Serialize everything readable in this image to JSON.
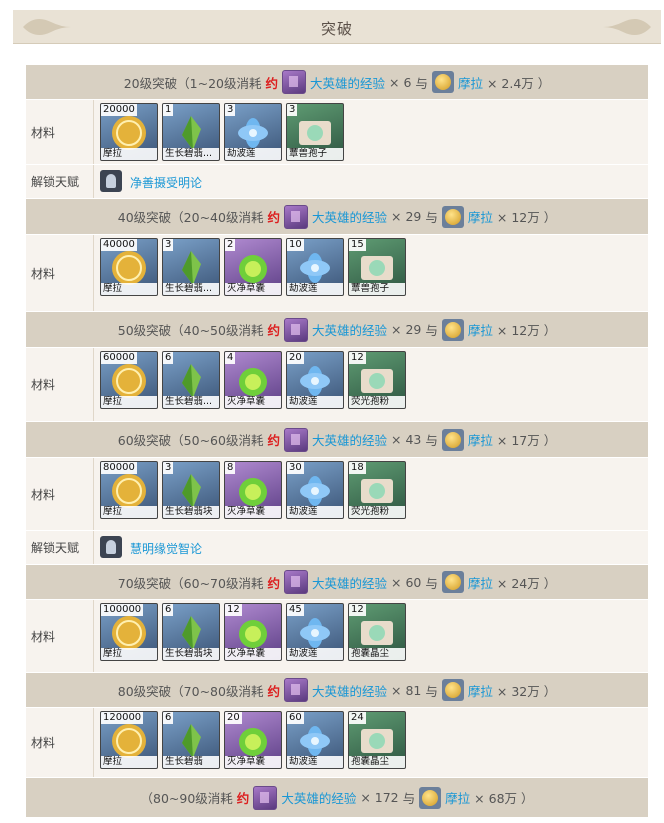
{
  "header": {
    "title": "突破"
  },
  "labels": {
    "materials": "材料",
    "unlock_talent": "解锁天赋",
    "about": "约",
    "and": "与"
  },
  "currency": {
    "exp_name": "大英雄的经验",
    "coin_name": "摩拉"
  },
  "phases": [
    {
      "text": "20级突破（1~20级消耗",
      "exp_count": "× 6",
      "mora_count": "× 2.4万 ）",
      "items": [
        {
          "count": "20000",
          "name": "摩拉",
          "icon": "mora-coin-icon"
        },
        {
          "count": "1",
          "name": "生长碧翡...",
          "icon": "green-gem-icon"
        },
        {
          "count": "3",
          "name": "劫波莲",
          "icon": "blue-lotus-icon"
        },
        {
          "count": "3",
          "name": "蕈兽孢子",
          "icon": "spore-icon"
        }
      ],
      "talent": "净善摄受明论"
    },
    {
      "text": "40级突破（20~40级消耗",
      "exp_count": "× 29",
      "mora_count": "× 12万 ）",
      "items": [
        {
          "count": "40000",
          "name": "摩拉",
          "icon": "mora-coin-icon"
        },
        {
          "count": "3",
          "name": "生长碧翡...",
          "icon": "green-gem-icon"
        },
        {
          "count": "2",
          "name": "灭净草囊",
          "icon": "herb-pod-icon"
        },
        {
          "count": "10",
          "name": "劫波莲",
          "icon": "blue-lotus-icon"
        },
        {
          "count": "15",
          "name": "蕈兽孢子",
          "icon": "spore-icon"
        }
      ]
    },
    {
      "text": "50级突破（40~50级消耗",
      "exp_count": "× 29",
      "mora_count": "× 12万 ）",
      "items": [
        {
          "count": "60000",
          "name": "摩拉",
          "icon": "mora-coin-icon"
        },
        {
          "count": "6",
          "name": "生长碧翡...",
          "icon": "green-gem-icon"
        },
        {
          "count": "4",
          "name": "灭净草囊",
          "icon": "herb-pod-icon"
        },
        {
          "count": "20",
          "name": "劫波莲",
          "icon": "blue-lotus-icon"
        },
        {
          "count": "12",
          "name": "荧光孢粉",
          "icon": "spore-icon"
        }
      ]
    },
    {
      "text": "60级突破（50~60级消耗",
      "exp_count": "× 43",
      "mora_count": "× 17万 ）",
      "items": [
        {
          "count": "80000",
          "name": "摩拉",
          "icon": "mora-coin-icon"
        },
        {
          "count": "3",
          "name": "生长碧翡块",
          "icon": "green-gem-icon"
        },
        {
          "count": "8",
          "name": "灭净草囊",
          "icon": "herb-pod-icon"
        },
        {
          "count": "30",
          "name": "劫波莲",
          "icon": "blue-lotus-icon"
        },
        {
          "count": "18",
          "name": "荧光孢粉",
          "icon": "spore-icon"
        }
      ],
      "talent": "慧明缘觉智论"
    },
    {
      "text": "70级突破（60~70级消耗",
      "exp_count": "× 60",
      "mora_count": "× 24万 ）",
      "items": [
        {
          "count": "100000",
          "name": "摩拉",
          "icon": "mora-coin-icon"
        },
        {
          "count": "6",
          "name": "生长碧翡块",
          "icon": "green-gem-icon"
        },
        {
          "count": "12",
          "name": "灭净草囊",
          "icon": "herb-pod-icon"
        },
        {
          "count": "45",
          "name": "劫波莲",
          "icon": "blue-lotus-icon"
        },
        {
          "count": "12",
          "name": "孢囊晶尘",
          "icon": "spore-icon"
        }
      ]
    },
    {
      "text": "80级突破（70~80级消耗",
      "exp_count": "× 81",
      "mora_count": "× 32万 ）",
      "items": [
        {
          "count": "120000",
          "name": "摩拉",
          "icon": "mora-coin-icon"
        },
        {
          "count": "6",
          "name": "生长碧翡",
          "icon": "green-gem-icon"
        },
        {
          "count": "20",
          "name": "灭净草囊",
          "icon": "herb-pod-icon"
        },
        {
          "count": "60",
          "name": "劫波莲",
          "icon": "blue-lotus-icon"
        },
        {
          "count": "24",
          "name": "孢囊晶尘",
          "icon": "spore-icon"
        }
      ]
    }
  ],
  "final": {
    "text": "（80~90级消耗",
    "exp_count": "× 172",
    "mora_count": "× 68万 ）"
  }
}
